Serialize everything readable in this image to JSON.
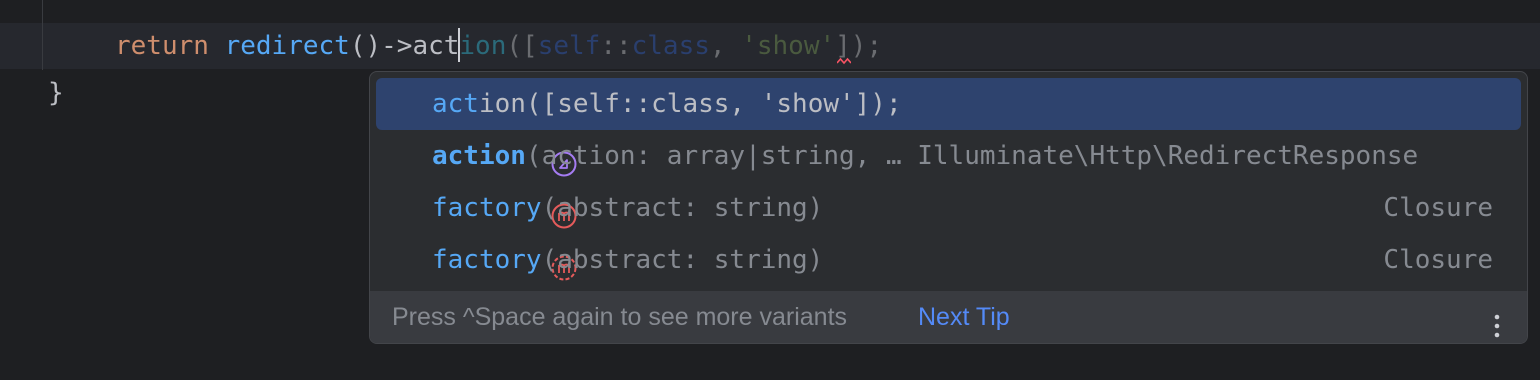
{
  "editor": {
    "line1": {
      "keyword": "return",
      "function": "redirect",
      "parens_arrow": "()->",
      "typed": "act",
      "ghost_fn_rest": "ion",
      "ghost_open": "([",
      "ghost_self": "self",
      "ghost_sep": "::",
      "ghost_class": "class",
      "ghost_comma": ", ",
      "ghost_str": "'show'",
      "ghost_close": "]);"
    },
    "line2": {
      "brace": "}"
    }
  },
  "completion": {
    "items": [
      {
        "icon": "live-template-icon",
        "highlight": "act",
        "rest": "ion([self::class, 'show']);",
        "signature": "",
        "type": ""
      },
      {
        "icon": "method-icon",
        "highlight": "action",
        "rest": "",
        "signature": "(action: array|string, … Illuminate\\Http\\RedirectResponse",
        "type": ""
      },
      {
        "icon": "method-static-icon",
        "highlight_a": "fact",
        "mid": "",
        "highlight_b": "",
        "name_full": "factory",
        "signature": "(abstract: string)",
        "type": "Closure"
      },
      {
        "icon": "method-icon",
        "name_full": "factory",
        "signature": "(abstract: string)",
        "type": "Closure"
      }
    ],
    "footer": {
      "tip": "Press ^Space again to see more variants",
      "next_tip": "Next Tip"
    }
  },
  "colors": {
    "background": "#1e1f22",
    "popup": "#2b2d30",
    "selected": "#2e436e",
    "accent": "#56a8f5",
    "link": "#548af7",
    "method_icon": "#e55b5b",
    "template_icon": "#a57cf2"
  }
}
